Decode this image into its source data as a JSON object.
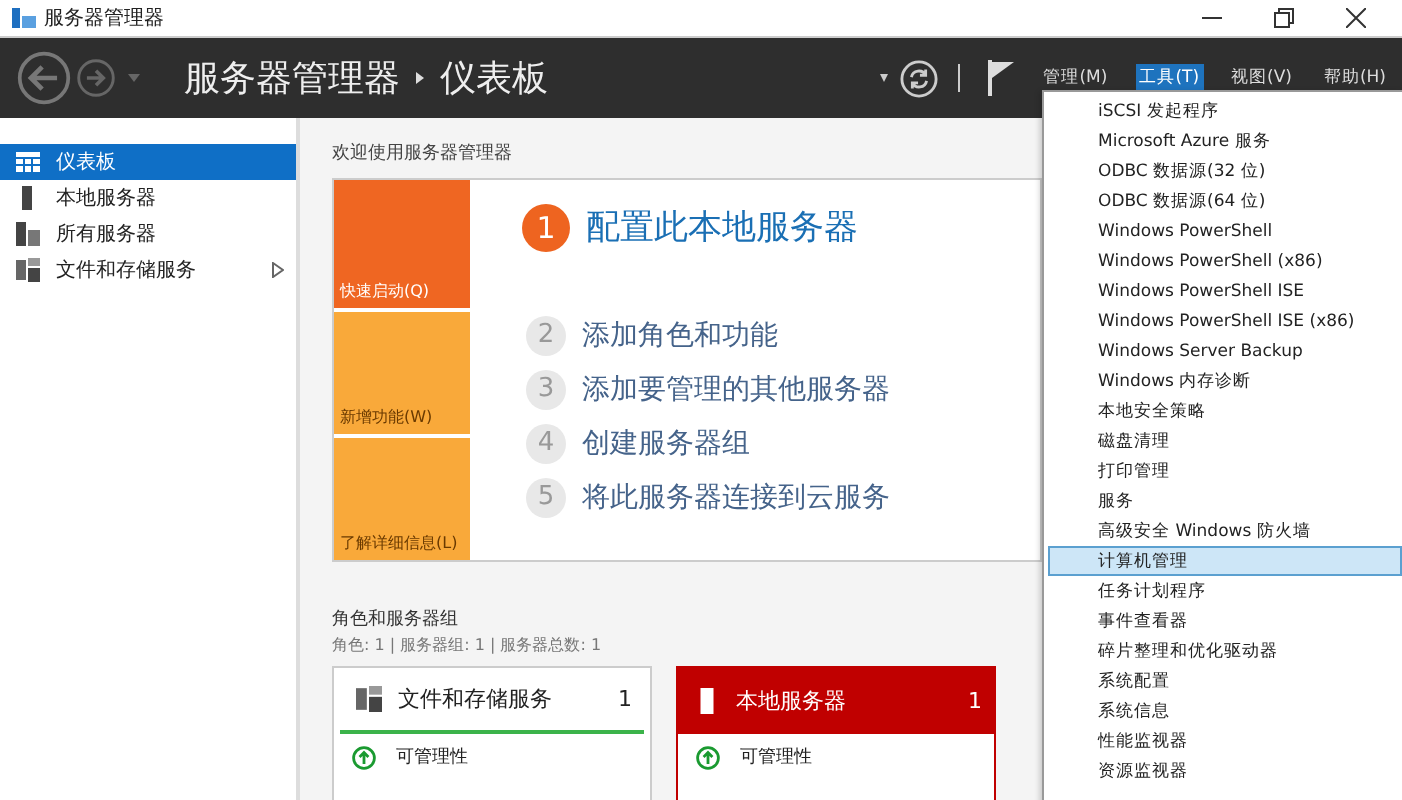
{
  "window": {
    "title": "服务器管理器"
  },
  "header": {
    "breadcrumb": [
      "服务器管理器",
      "仪表板"
    ],
    "menu": [
      {
        "label": "管理(M)",
        "selected": false
      },
      {
        "label": "工具(T)",
        "selected": true
      },
      {
        "label": "视图(V)",
        "selected": false
      },
      {
        "label": "帮助(H)",
        "selected": false
      }
    ]
  },
  "sidebar": {
    "items": [
      {
        "label": "仪表板",
        "kind": "dashboard",
        "selected": true,
        "expandable": false
      },
      {
        "label": "本地服务器",
        "kind": "server",
        "selected": false,
        "expandable": false
      },
      {
        "label": "所有服务器",
        "kind": "servers",
        "selected": false,
        "expandable": false
      },
      {
        "label": "文件和存储服务",
        "kind": "storage",
        "selected": false,
        "expandable": true
      }
    ]
  },
  "welcome": {
    "title": "欢迎使用服务器管理器",
    "tiles": [
      {
        "label": "快速启动(Q)",
        "selected": true
      },
      {
        "label": "新增功能(W)",
        "selected": false
      },
      {
        "label": "了解详细信息(L)",
        "selected": false
      }
    ],
    "steps": [
      {
        "number": "1",
        "label": "配置此本地服务器",
        "selected": true
      },
      {
        "number": "2",
        "label": "添加角色和功能",
        "selected": false
      },
      {
        "number": "3",
        "label": "添加要管理的其他服务器",
        "selected": false
      },
      {
        "number": "4",
        "label": "创建服务器组",
        "selected": false
      },
      {
        "number": "5",
        "label": "将此服务器连接到云服务",
        "selected": false
      }
    ]
  },
  "roles": {
    "title": "角色和服务器组",
    "summary": "角色: 1 | 服务器组: 1 | 服务器总数: 1",
    "cards": [
      {
        "name": "文件和存储服务",
        "count": "1",
        "kind": "storage",
        "alert": false,
        "rows": [
          "可管理性"
        ]
      },
      {
        "name": "本地服务器",
        "count": "1",
        "kind": "server",
        "alert": true,
        "rows": [
          "可管理性"
        ]
      }
    ]
  },
  "tools_menu": {
    "items": [
      {
        "label": "iSCSI 发起程序",
        "selected": false
      },
      {
        "label": "Microsoft Azure 服务",
        "selected": false
      },
      {
        "label": "ODBC 数据源(32 位)",
        "selected": false
      },
      {
        "label": "ODBC 数据源(64 位)",
        "selected": false
      },
      {
        "label": "Windows PowerShell",
        "selected": false
      },
      {
        "label": "Windows PowerShell (x86)",
        "selected": false
      },
      {
        "label": "Windows PowerShell ISE",
        "selected": false
      },
      {
        "label": "Windows PowerShell ISE (x86)",
        "selected": false
      },
      {
        "label": "Windows Server Backup",
        "selected": false
      },
      {
        "label": "Windows 内存诊断",
        "selected": false
      },
      {
        "label": "本地安全策略",
        "selected": false
      },
      {
        "label": "磁盘清理",
        "selected": false
      },
      {
        "label": "打印管理",
        "selected": false
      },
      {
        "label": "服务",
        "selected": false
      },
      {
        "label": "高级安全 Windows 防火墙",
        "selected": false
      },
      {
        "label": "计算机管理",
        "selected": true
      },
      {
        "label": "任务计划程序",
        "selected": false
      },
      {
        "label": "事件查看器",
        "selected": false
      },
      {
        "label": "碎片整理和优化驱动器",
        "selected": false
      },
      {
        "label": "系统配置",
        "selected": false
      },
      {
        "label": "系统信息",
        "selected": false
      },
      {
        "label": "性能监视器",
        "selected": false
      },
      {
        "label": "资源监视器",
        "selected": false
      }
    ]
  }
}
